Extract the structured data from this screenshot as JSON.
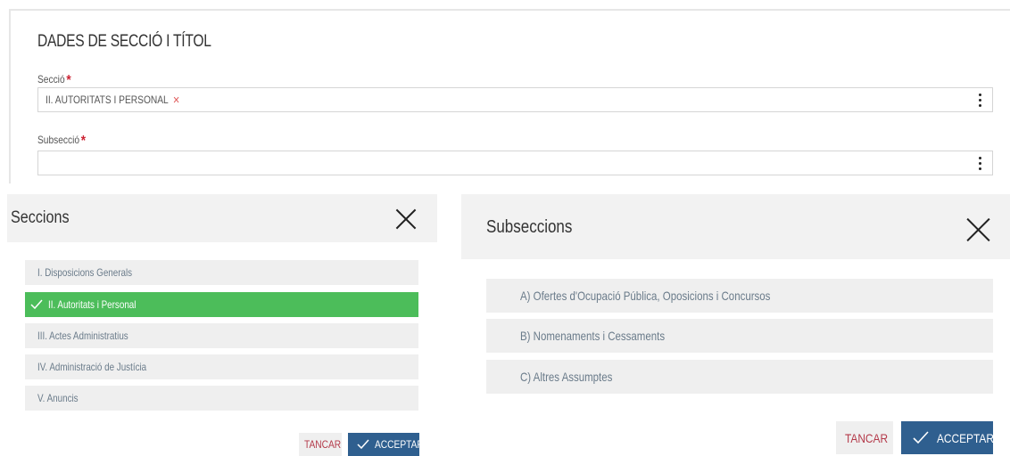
{
  "form": {
    "title": "DADES DE SECCIÓ I TÍTOL",
    "seccio_label": "Secció",
    "seccio_value": "II. AUTORITATS I PERSONAL",
    "subseccio_label": "Subsecció",
    "subseccio_value": "",
    "required_mark": "*",
    "clear_icon": "×"
  },
  "seccions_modal": {
    "title": "Seccions",
    "options": [
      {
        "label": "I. Disposicions Generals",
        "selected": false
      },
      {
        "label": "II. Autoritats i Personal",
        "selected": true
      },
      {
        "label": "III. Actes Administratius",
        "selected": false
      },
      {
        "label": "IV. Administració de Justícia",
        "selected": false
      },
      {
        "label": "V. Anuncis",
        "selected": false
      }
    ],
    "cancel_label": "TANCAR",
    "accept_label": "ACCEPTAR"
  },
  "subseccions_modal": {
    "title": "Subseccions",
    "options": [
      {
        "label": "A) Ofertes d'Ocupació Pública, Oposicions i Concursos"
      },
      {
        "label": "B) Nomenaments i Cessaments"
      },
      {
        "label": "C) Altres Assumptes"
      }
    ],
    "cancel_label": "TANCAR",
    "accept_label": "ACCEPTAR"
  },
  "colors": {
    "selected": "#4cbd5a",
    "accept": "#2f5f8f",
    "cancel_text": "#b43a4a",
    "required": "#cc2233"
  },
  "icons": {
    "close": "close-icon",
    "check": "check-icon",
    "menu": "kebab-menu-icon"
  }
}
